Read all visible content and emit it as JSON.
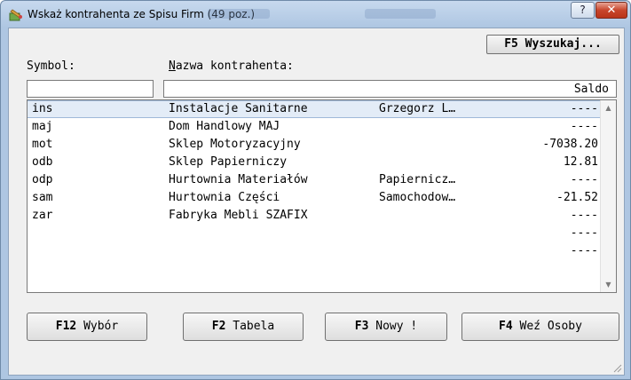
{
  "window": {
    "title": "Wskaż kontrahenta ze Spisu Firm (49 poz.)",
    "help_label": "?",
    "close_label": "✕"
  },
  "toolbar": {
    "search_label": "F5 Wyszukaj..."
  },
  "labels": {
    "symbol": "Symbol:",
    "name_underlined": "N",
    "name_rest": "azwa kontrahenta:",
    "saldo": "Saldo"
  },
  "rows": [
    {
      "symbol": "ins",
      "name": "Instalacje Sanitarne",
      "extra": "Grzegorz L…",
      "saldo": "----"
    },
    {
      "symbol": "maj",
      "name": "Dom Handlowy MAJ",
      "extra": "",
      "saldo": "----"
    },
    {
      "symbol": "mot",
      "name": "Sklep Motoryzacyjny",
      "extra": "",
      "saldo": "-7038.20"
    },
    {
      "symbol": "odb",
      "name": "Sklep Papierniczy",
      "extra": "",
      "saldo": "12.81"
    },
    {
      "symbol": "odp",
      "name": "Hurtownia Materiałów",
      "extra": "Papiernicz…",
      "saldo": "----"
    },
    {
      "symbol": "sam",
      "name": "Hurtownia Części",
      "extra": "Samochodow…",
      "saldo": "-21.52"
    },
    {
      "symbol": "zar",
      "name": "Fabryka Mebli SZAFIX",
      "extra": "",
      "saldo": "----"
    },
    {
      "symbol": "",
      "name": "",
      "extra": "",
      "saldo": "----"
    },
    {
      "symbol": "",
      "name": "",
      "extra": "",
      "saldo": "----"
    }
  ],
  "buttons": {
    "wybor_key": "F12",
    "wybor_label": "Wybór",
    "tabela_key": "F2",
    "tabela_label": "Tabela",
    "nowy_key": "F3",
    "nowy_label": "Nowy !",
    "osoby_key": "F4",
    "osoby_label": "Weź Osoby"
  },
  "colors": {
    "selection": "#e3ecf7",
    "close": "#c8452b"
  }
}
